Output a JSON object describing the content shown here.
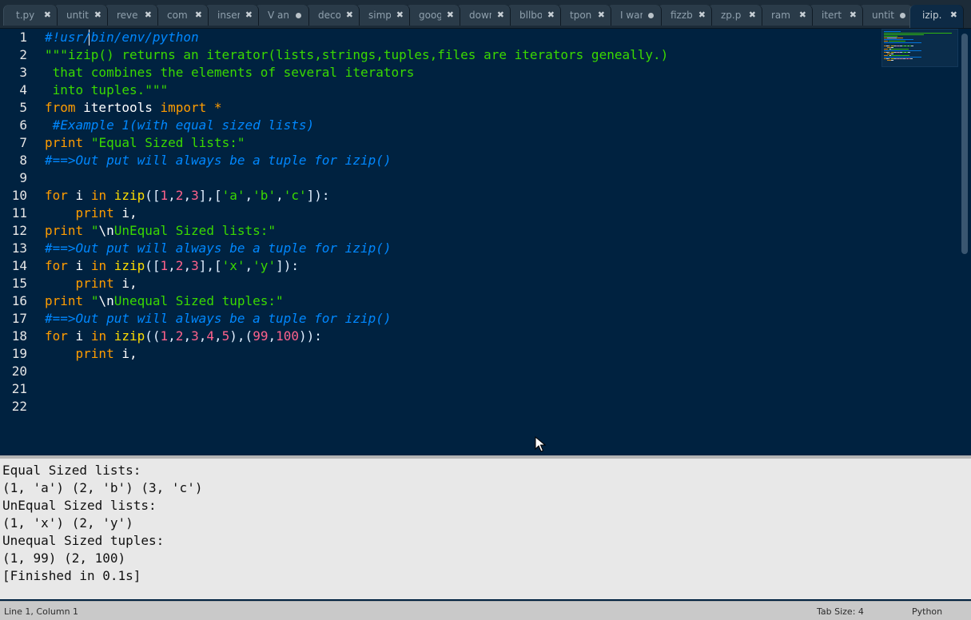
{
  "tabs": [
    {
      "label": "t.py",
      "state": "close"
    },
    {
      "label": "untit",
      "state": "close"
    },
    {
      "label": "reve",
      "state": "close"
    },
    {
      "label": "com",
      "state": "close"
    },
    {
      "label": "inser",
      "state": "close"
    },
    {
      "label": "V an",
      "state": "dirty"
    },
    {
      "label": "deco",
      "state": "close"
    },
    {
      "label": "simp",
      "state": "close"
    },
    {
      "label": "goog",
      "state": "close"
    },
    {
      "label": "down",
      "state": "close"
    },
    {
      "label": "bllbo",
      "state": "close"
    },
    {
      "label": "tpon",
      "state": "close"
    },
    {
      "label": "I war",
      "state": "dirty"
    },
    {
      "label": "fizzb",
      "state": "close"
    },
    {
      "label": "zp.p",
      "state": "close"
    },
    {
      "label": "ram",
      "state": "close"
    },
    {
      "label": "itert",
      "state": "close"
    },
    {
      "label": "untit",
      "state": "dirty"
    },
    {
      "label": "izip.",
      "state": "close",
      "active": true
    }
  ],
  "tab_close_glyph": "✖",
  "line_numbers": [
    "1",
    "2",
    "3",
    "4",
    "5",
    "6",
    "7",
    "8",
    "9",
    "10",
    "11",
    "12",
    "13",
    "14",
    "15",
    "16",
    "17",
    "18",
    "19",
    "20",
    "21",
    "22"
  ],
  "code_lines": [
    [
      {
        "t": "#!usr/bin/env/python",
        "c": "comment"
      }
    ],
    [
      {
        "t": "\"\"\"izip() returns an iterator(lists,strings,tuples,files are iterators geneally.)",
        "c": "string"
      }
    ],
    [
      {
        "t": " that combines the elements of several iterators",
        "c": "string"
      }
    ],
    [
      {
        "t": " into tuples.\"\"\"",
        "c": "string"
      }
    ],
    [
      {
        "t": "from",
        "c": "keyword"
      },
      {
        "t": " itertools ",
        "c": "plain"
      },
      {
        "t": "import",
        "c": "keyword"
      },
      {
        "t": " *",
        "c": "keyword"
      }
    ],
    [
      {
        "t": " #Example 1(with equal sized lists)",
        "c": "comment"
      }
    ],
    [
      {
        "t": "print",
        "c": "keyword"
      },
      {
        "t": " ",
        "c": "plain"
      },
      {
        "t": "\"Equal Sized lists:\"",
        "c": "string"
      }
    ],
    [
      {
        "t": "#==>Out put will always be a tuple for izip()",
        "c": "comment"
      }
    ],
    [],
    [
      {
        "t": "for",
        "c": "keyword"
      },
      {
        "t": " i ",
        "c": "plain"
      },
      {
        "t": "in",
        "c": "keyword"
      },
      {
        "t": " ",
        "c": "plain"
      },
      {
        "t": "izip",
        "c": "func"
      },
      {
        "t": "([",
        "c": "paren"
      },
      {
        "t": "1",
        "c": "number"
      },
      {
        "t": ",",
        "c": "paren"
      },
      {
        "t": "2",
        "c": "number"
      },
      {
        "t": ",",
        "c": "paren"
      },
      {
        "t": "3",
        "c": "number"
      },
      {
        "t": "],[",
        "c": "paren"
      },
      {
        "t": "'a'",
        "c": "string"
      },
      {
        "t": ",",
        "c": "paren"
      },
      {
        "t": "'b'",
        "c": "string"
      },
      {
        "t": ",",
        "c": "paren"
      },
      {
        "t": "'c'",
        "c": "string"
      },
      {
        "t": "]):",
        "c": "paren"
      }
    ],
    [
      {
        "t": "    ",
        "c": "plain"
      },
      {
        "t": "print",
        "c": "keyword"
      },
      {
        "t": " i,",
        "c": "plain"
      }
    ],
    [
      {
        "t": "print",
        "c": "keyword"
      },
      {
        "t": " ",
        "c": "plain"
      },
      {
        "t": "\"",
        "c": "string"
      },
      {
        "t": "\\n",
        "c": "escape"
      },
      {
        "t": "UnEqual Sized lists:\"",
        "c": "string"
      }
    ],
    [
      {
        "t": "#==>Out put will always be a tuple for izip()",
        "c": "comment"
      }
    ],
    [
      {
        "t": "for",
        "c": "keyword"
      },
      {
        "t": " i ",
        "c": "plain"
      },
      {
        "t": "in",
        "c": "keyword"
      },
      {
        "t": " ",
        "c": "plain"
      },
      {
        "t": "izip",
        "c": "func"
      },
      {
        "t": "([",
        "c": "paren"
      },
      {
        "t": "1",
        "c": "number"
      },
      {
        "t": ",",
        "c": "paren"
      },
      {
        "t": "2",
        "c": "number"
      },
      {
        "t": ",",
        "c": "paren"
      },
      {
        "t": "3",
        "c": "number"
      },
      {
        "t": "],[",
        "c": "paren"
      },
      {
        "t": "'x'",
        "c": "string"
      },
      {
        "t": ",",
        "c": "paren"
      },
      {
        "t": "'y'",
        "c": "string"
      },
      {
        "t": "]):",
        "c": "paren"
      }
    ],
    [
      {
        "t": "    ",
        "c": "plain"
      },
      {
        "t": "print",
        "c": "keyword"
      },
      {
        "t": " i,",
        "c": "plain"
      }
    ],
    [
      {
        "t": "print",
        "c": "keyword"
      },
      {
        "t": " ",
        "c": "plain"
      },
      {
        "t": "\"",
        "c": "string"
      },
      {
        "t": "\\n",
        "c": "escape"
      },
      {
        "t": "Unequal Sized tuples:\"",
        "c": "string"
      }
    ],
    [
      {
        "t": "#==>Out put will always be a tuple for izip()",
        "c": "comment"
      }
    ],
    [
      {
        "t": "for",
        "c": "keyword"
      },
      {
        "t": " i ",
        "c": "plain"
      },
      {
        "t": "in",
        "c": "keyword"
      },
      {
        "t": " ",
        "c": "plain"
      },
      {
        "t": "izip",
        "c": "func"
      },
      {
        "t": "((",
        "c": "paren"
      },
      {
        "t": "1",
        "c": "number"
      },
      {
        "t": ",",
        "c": "paren"
      },
      {
        "t": "2",
        "c": "number"
      },
      {
        "t": ",",
        "c": "paren"
      },
      {
        "t": "3",
        "c": "number"
      },
      {
        "t": ",",
        "c": "paren"
      },
      {
        "t": "4",
        "c": "number"
      },
      {
        "t": ",",
        "c": "paren"
      },
      {
        "t": "5",
        "c": "number"
      },
      {
        "t": "),(",
        "c": "paren"
      },
      {
        "t": "99",
        "c": "number"
      },
      {
        "t": ",",
        "c": "paren"
      },
      {
        "t": "100",
        "c": "number"
      },
      {
        "t": ")):",
        "c": "paren"
      }
    ],
    [
      {
        "t": "    ",
        "c": "plain"
      },
      {
        "t": "print",
        "c": "keyword"
      },
      {
        "t": " i,",
        "c": "plain"
      }
    ],
    [],
    [],
    []
  ],
  "output": {
    "lines": [
      "Equal Sized lists:",
      "(1, 'a') (2, 'b') (3, 'c')",
      "UnEqual Sized lists:",
      "(1, 'x') (2, 'y')",
      "Unequal Sized tuples:",
      "(1, 99) (2, 100)",
      "[Finished in 0.1s]"
    ]
  },
  "status": {
    "position": "Line 1, Column 1",
    "tab_size": "Tab Size: 4",
    "syntax": "Python"
  },
  "theme": {
    "editor_bg": "#002240",
    "keyword": "#ff9d00",
    "comment": "#0088ff",
    "string": "#3ad900",
    "number": "#ff628c",
    "function": "#ffdd00"
  }
}
